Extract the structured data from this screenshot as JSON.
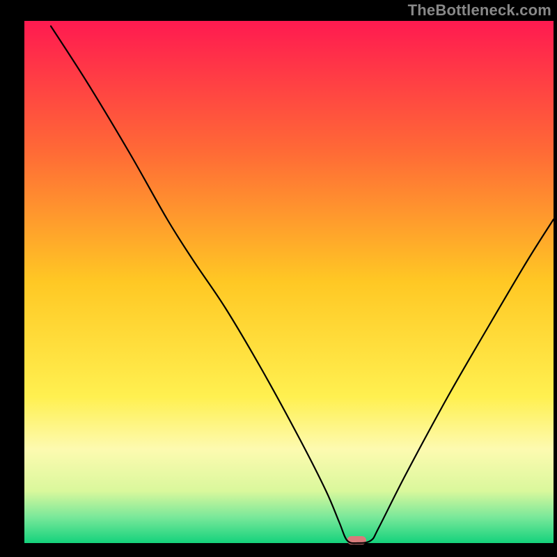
{
  "watermark": "TheBottleneck.com",
  "chart_data": {
    "type": "line",
    "title": "",
    "xlabel": "",
    "ylabel": "",
    "xlim": [
      0,
      100
    ],
    "ylim": [
      0,
      100
    ],
    "grid": false,
    "legend": false,
    "background": {
      "orientation": "vertical",
      "stops": [
        {
          "offset": 0.0,
          "color": "#ff1a50"
        },
        {
          "offset": 0.25,
          "color": "#ff6a36"
        },
        {
          "offset": 0.5,
          "color": "#ffc824"
        },
        {
          "offset": 0.72,
          "color": "#fff050"
        },
        {
          "offset": 0.82,
          "color": "#fdfab0"
        },
        {
          "offset": 0.9,
          "color": "#daf89c"
        },
        {
          "offset": 0.95,
          "color": "#7ae89a"
        },
        {
          "offset": 1.0,
          "color": "#14d27c"
        }
      ]
    },
    "marker": {
      "x": 62.8,
      "y": 0,
      "color": "#d87b7b",
      "width": 3.6,
      "height": 1.6
    },
    "series": [
      {
        "name": "bottleneck-curve",
        "color": "#000000",
        "x": [
          5.0,
          12.0,
          20.0,
          27.0,
          32.0,
          38.0,
          45.0,
          52.0,
          57.0,
          59.5,
          61.0,
          63.0,
          65.5,
          67.0,
          72.0,
          80.0,
          88.0,
          95.0,
          100.0
        ],
        "y": [
          99.0,
          88.0,
          74.5,
          62.0,
          54.0,
          45.0,
          33.0,
          20.0,
          10.0,
          4.0,
          0.5,
          0.0,
          0.5,
          3.0,
          13.0,
          28.0,
          42.0,
          54.0,
          62.0
        ]
      }
    ]
  }
}
